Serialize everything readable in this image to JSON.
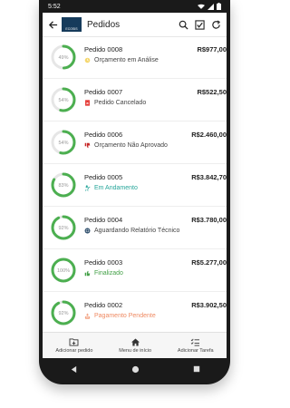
{
  "status_bar": {
    "time": "5:52"
  },
  "app_bar": {
    "title": "Pedidos",
    "logo_text": "ECOSIS"
  },
  "orders": [
    {
      "percent": "49%",
      "progress": 49,
      "title": "Pedido 0008",
      "status": "Orçamento em Análise",
      "status_icon": "clock-icon",
      "status_color": "#444444",
      "price": "R$977,00",
      "ring_color": "#4caf50"
    },
    {
      "percent": "54%",
      "progress": 54,
      "title": "Pedido 0007",
      "status": "Pedido Cancelado",
      "status_icon": "document-cancel-icon",
      "status_color": "#444444",
      "price": "R$522,50",
      "ring_color": "#4caf50"
    },
    {
      "percent": "54%",
      "progress": 54,
      "title": "Pedido 0006",
      "status": "Orçamento Não Aprovado",
      "status_icon": "thumbs-down-icon",
      "status_color": "#444444",
      "price": "R$2.460,00",
      "ring_color": "#4caf50"
    },
    {
      "percent": "83%",
      "progress": 83,
      "title": "Pedido 0005",
      "status": "Em Andamento",
      "status_icon": "worker-icon",
      "status_color": "#26a69a",
      "price": "R$3.842,70",
      "ring_color": "#4caf50"
    },
    {
      "percent": "92%",
      "progress": 92,
      "title": "Pedido 0004",
      "status": "Aguardando Relatório Técnico",
      "status_icon": "report-icon",
      "status_color": "#444444",
      "price": "R$3.780,00",
      "ring_color": "#4caf50"
    },
    {
      "percent": "100%",
      "progress": 100,
      "title": "Pedido 0003",
      "status": "Finalizado",
      "status_icon": "thumbs-up-icon",
      "status_color": "#43a047",
      "price": "R$5.277,00",
      "ring_color": "#4caf50"
    },
    {
      "percent": "92%",
      "progress": 92,
      "title": "Pedido 0002",
      "status": "Pagamento Pendente",
      "status_icon": "payment-icon",
      "status_color": "#ef8a62",
      "price": "R$3.902,50",
      "ring_color": "#4caf50"
    }
  ],
  "bottom_nav": {
    "add_order": "Adicionar pedido",
    "home": "Menu de início",
    "add_task": "Adicionar Tarefa"
  },
  "colors": {
    "accent": "#4caf50",
    "track": "#e6e6e6"
  }
}
